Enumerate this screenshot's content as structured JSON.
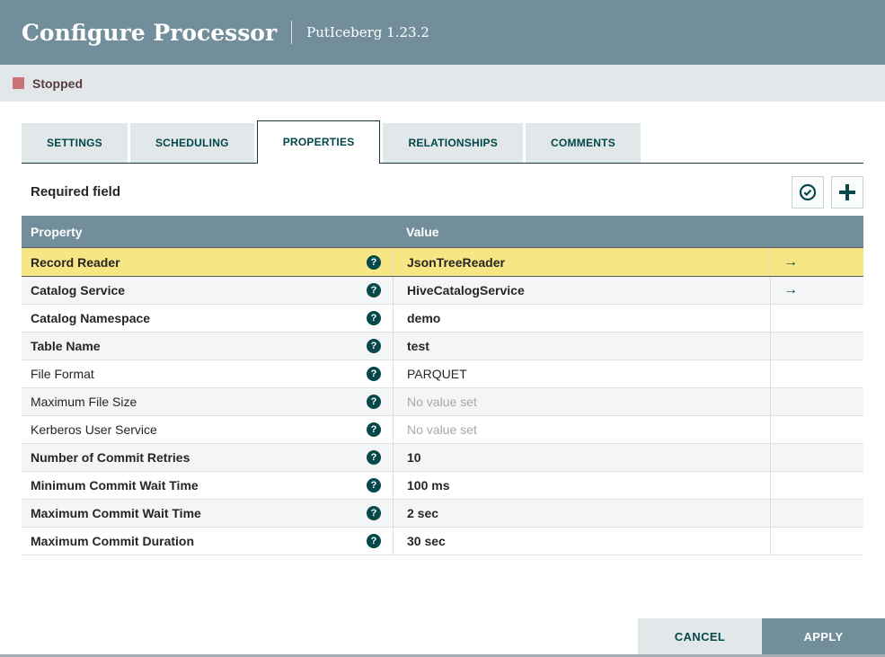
{
  "header": {
    "title": "Configure Processor",
    "subtitle": "PutIceberg 1.23.2"
  },
  "status": {
    "label": "Stopped",
    "color": "#C97277"
  },
  "tabs": [
    {
      "label": "SETTINGS",
      "active": false
    },
    {
      "label": "SCHEDULING",
      "active": false
    },
    {
      "label": "PROPERTIES",
      "active": true
    },
    {
      "label": "RELATIONSHIPS",
      "active": false
    },
    {
      "label": "COMMENTS",
      "active": false
    }
  ],
  "toolbar": {
    "required_label": "Required field"
  },
  "icons": {
    "verify": "check-circle-icon",
    "add": "plus-icon",
    "help": "question-circle-icon",
    "help_glyph": "?",
    "link": "right-arrow-icon",
    "link_glyph": "→",
    "status": "stopped-square-icon"
  },
  "table": {
    "columns": [
      "Property",
      "Value"
    ],
    "rows": [
      {
        "property": "Record Reader",
        "value": "JsonTreeReader",
        "required": true,
        "highlighted": true,
        "has_link": true,
        "no_value": false
      },
      {
        "property": "Catalog Service",
        "value": "HiveCatalogService",
        "required": true,
        "highlighted": false,
        "has_link": true,
        "no_value": false
      },
      {
        "property": "Catalog Namespace",
        "value": "demo",
        "required": true,
        "highlighted": false,
        "has_link": false,
        "no_value": false
      },
      {
        "property": "Table Name",
        "value": "test",
        "required": true,
        "highlighted": false,
        "has_link": false,
        "no_value": false
      },
      {
        "property": "File Format",
        "value": "PARQUET",
        "required": false,
        "highlighted": false,
        "has_link": false,
        "no_value": false
      },
      {
        "property": "Maximum File Size",
        "value": "No value set",
        "required": false,
        "highlighted": false,
        "has_link": false,
        "no_value": true
      },
      {
        "property": "Kerberos User Service",
        "value": "No value set",
        "required": false,
        "highlighted": false,
        "has_link": false,
        "no_value": true
      },
      {
        "property": "Number of Commit Retries",
        "value": "10",
        "required": true,
        "highlighted": false,
        "has_link": false,
        "no_value": false
      },
      {
        "property": "Minimum Commit Wait Time",
        "value": "100 ms",
        "required": true,
        "highlighted": false,
        "has_link": false,
        "no_value": false
      },
      {
        "property": "Maximum Commit Wait Time",
        "value": "2 sec",
        "required": true,
        "highlighted": false,
        "has_link": false,
        "no_value": false
      },
      {
        "property": "Maximum Commit Duration",
        "value": "30 sec",
        "required": true,
        "highlighted": false,
        "has_link": false,
        "no_value": false
      }
    ]
  },
  "footer": {
    "cancel_label": "CANCEL",
    "apply_label": "APPLY"
  },
  "colors": {
    "accent": "#004849",
    "titlebar_bg": "#728E9B",
    "statusbar_bg": "#E2E7E9",
    "highlight_row": "#F7E784",
    "table_header_bg": "#728E9B"
  }
}
